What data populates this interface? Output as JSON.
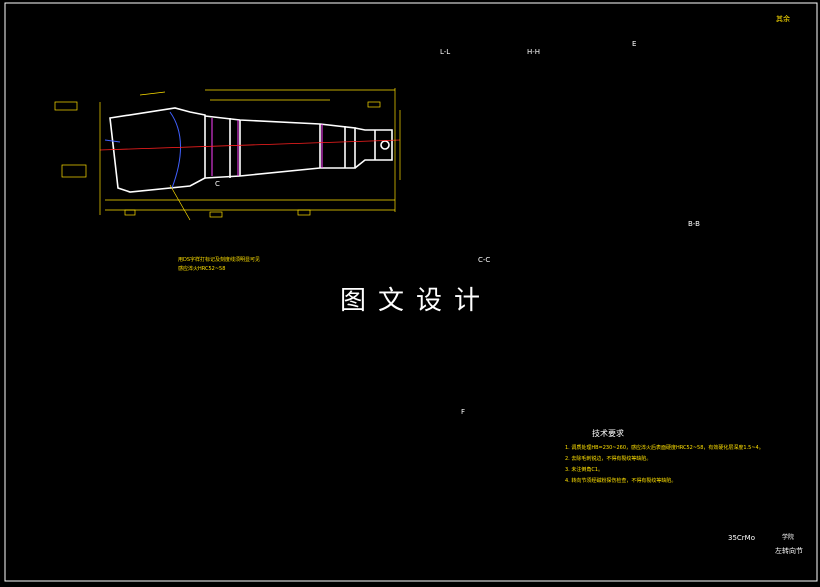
{
  "watermark": "图文设计",
  "section_labels": {
    "lc": "L-L",
    "hh": "H-H",
    "e": "E",
    "bb": "B-B",
    "cc": "C-C",
    "f": "F",
    "c": "C",
    "roughness_other": "其余"
  },
  "tech_requirements": {
    "title": "技术要求",
    "items": [
      "1. 调质处理HB=230~260，感应淬火后表面硬度HRC52~58，有效硬化层深度1.5~4。",
      "2. 去除毛刺锐边，不得有裂纹等缺陷。",
      "3. 未注倒角C1。",
      "4. 转向节须经磁粉探伤检查，不得有裂纹等缺陷。"
    ]
  },
  "notes": {
    "treatment_line1": "用DS字样打标记及刻度线须明显可见",
    "treatment_line2": "感应淬火HRC52~58"
  },
  "title_block": {
    "material": "35CrMo",
    "school": "学院",
    "part_name": "左转向节"
  },
  "colors": {
    "background": "#000000",
    "outline": "#ffffff",
    "dimension": "#ffe000",
    "center_line": "#ff2020",
    "hidden": "#ff40ff",
    "hatch": "#40c0c0",
    "blue": "#4060ff",
    "green": "#40ff40"
  }
}
